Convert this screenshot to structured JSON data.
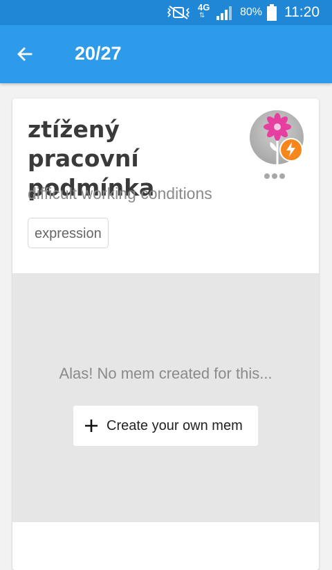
{
  "status_bar": {
    "network": "4G",
    "battery": "80%",
    "time": "11:20"
  },
  "app_bar": {
    "counter": "20/27"
  },
  "card": {
    "word": "ztížený pracovní podmínka",
    "translation": "difficult working conditions",
    "tag": "expression",
    "mem_empty_text": "Alas! No mem created for this...",
    "create_mem_label": "Create your own mem"
  },
  "colors": {
    "status_bar": "#1f87d6",
    "app_bar": "#2d9bea",
    "badge": "#f7861b",
    "flower": "#e63fa0"
  }
}
